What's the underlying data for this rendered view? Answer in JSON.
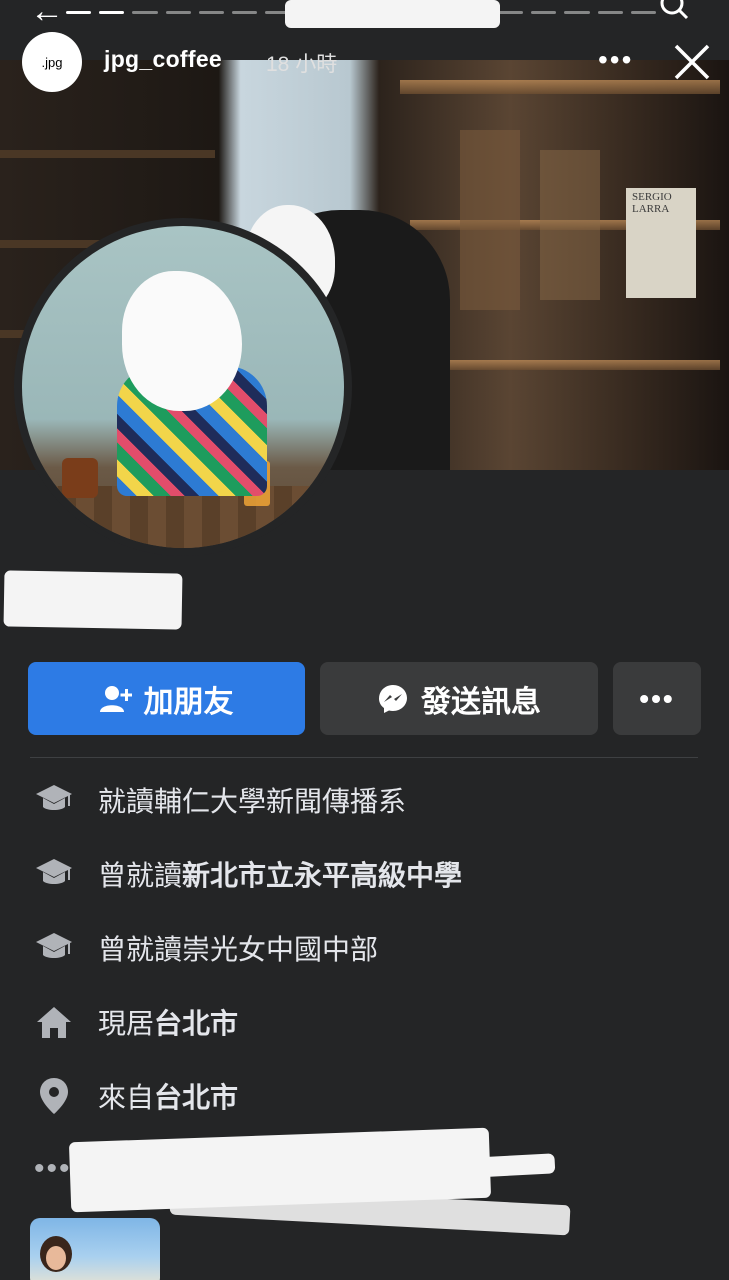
{
  "story": {
    "username": "jpg_coffee",
    "time": "18 小時",
    "avatar_text": ".jpg",
    "more_label": "•••"
  },
  "cover": {
    "book_title": "SERGIO LARRA"
  },
  "actions": {
    "add_friend": "加朋友",
    "send_message": "發送訊息",
    "more": "•••"
  },
  "info": [
    {
      "icon": "graduation-cap-icon",
      "prefix": "就讀",
      "text": "輔仁大學新聞傳播系",
      "bold": false
    },
    {
      "icon": "graduation-cap-icon",
      "prefix": "曾就讀",
      "text": "新北市立永平高級中學",
      "bold": true
    },
    {
      "icon": "graduation-cap-icon",
      "prefix": "曾就讀",
      "text": "崇光女中國中部",
      "bold": false
    },
    {
      "icon": "home-icon",
      "prefix": "現居",
      "text": "台北市",
      "bold": true
    },
    {
      "icon": "location-pin-icon",
      "prefix": "來自",
      "text": "台北市",
      "bold": true
    }
  ],
  "more_info": "•••",
  "colors": {
    "background": "#242526",
    "primary_button": "#2d7be5",
    "secondary_button": "#3a3b3c",
    "text": "#e4e6eb"
  }
}
